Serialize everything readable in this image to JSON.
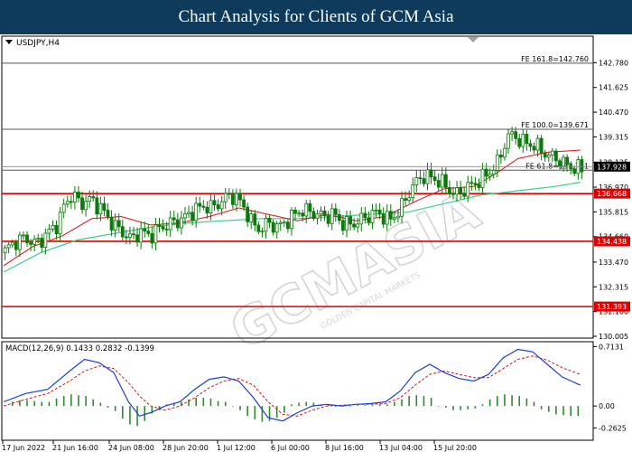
{
  "page": {
    "title": "Chart Analysis for Clients of GCM Asia"
  },
  "watermark": {
    "brand": "GCMASIA",
    "sub": "GOLDEN CAPITAL MARKETS"
  },
  "colors": {
    "candle": "#0a7a0a",
    "sma_fast": "#e01010",
    "sma_slow": "#38d08a",
    "sr_line": "#e00000",
    "fibo_line": "#555555",
    "price_badge": "#000000",
    "macd_line": "#1a3ee0",
    "signal_line": "#e01010",
    "hist": "#2e8b2e"
  },
  "chart_data": [
    {
      "type": "candlestick",
      "symbol_label": "USDJPY,H4",
      "ylim": [
        130.005,
        143.935
      ],
      "y_ticks": [
        "142.780",
        "141.625",
        "140.470",
        "139.315",
        "138.125",
        "136.970",
        "135.815",
        "134.660",
        "133.470",
        "132.315",
        "131.160",
        "130.005"
      ],
      "x_ticks": [
        "17 Jun 2022",
        "21 Jun 16:00",
        "24 Jun 08:00",
        "28 Jun 20:00",
        "1 Jul 12:00",
        "6 Jul 00:00",
        "8 Jul 16:00",
        "13 Jul 04:00",
        "15 Jul 20:00"
      ],
      "support_resistance": [
        {
          "label": "136.668",
          "value": 136.668
        },
        {
          "label": "134.438",
          "value": 134.438
        },
        {
          "label": "131.393",
          "value": 131.393
        }
      ],
      "fibonacci": [
        {
          "label": "FE 161.8=142.760",
          "value": 142.76
        },
        {
          "label": "FE 100.0=139.671",
          "value": 139.671
        },
        {
          "label": "FE 61.8=137.761",
          "value": 137.761
        }
      ],
      "current_price": {
        "label": "137.928",
        "value": 137.928
      },
      "price_path": [
        [
          0,
          133.9
        ],
        [
          3,
          134.4
        ],
        [
          6,
          134.6
        ],
        [
          9,
          134.3
        ],
        [
          12,
          134.8
        ],
        [
          15,
          135.3
        ],
        [
          17,
          136.3
        ],
        [
          19,
          136.6
        ],
        [
          21,
          136.2
        ],
        [
          24,
          136.4
        ],
        [
          27,
          135.9
        ],
        [
          30,
          135.2
        ],
        [
          33,
          134.8
        ],
        [
          35,
          134.5
        ],
        [
          37,
          134.9
        ],
        [
          40,
          134.7
        ],
        [
          43,
          135.1
        ],
        [
          46,
          135.3
        ],
        [
          49,
          135.5
        ],
        [
          52,
          135.9
        ],
        [
          55,
          136.1
        ],
        [
          57,
          136.0
        ],
        [
          60,
          136.4
        ],
        [
          62,
          136.6
        ],
        [
          64,
          136.4
        ],
        [
          66,
          135.9
        ],
        [
          68,
          135.2
        ],
        [
          70,
          135.0
        ],
        [
          72,
          135.3
        ],
        [
          75,
          135.1
        ],
        [
          78,
          135.5
        ],
        [
          81,
          135.9
        ],
        [
          84,
          135.8
        ],
        [
          87,
          135.6
        ],
        [
          90,
          135.7
        ],
        [
          93,
          135.2
        ],
        [
          96,
          135.3
        ],
        [
          99,
          135.6
        ],
        [
          102,
          135.8
        ],
        [
          105,
          135.4
        ],
        [
          108,
          135.9
        ],
        [
          111,
          136.9
        ],
        [
          114,
          137.5
        ],
        [
          117,
          137.4
        ],
        [
          120,
          137.1
        ],
        [
          123,
          136.6
        ],
        [
          126,
          136.9
        ],
        [
          129,
          137.2
        ],
        [
          132,
          137.6
        ],
        [
          135,
          138.2
        ],
        [
          137,
          139.3
        ],
        [
          139,
          139.4
        ],
        [
          141,
          139.1
        ],
        [
          143,
          139.0
        ],
        [
          145,
          138.9
        ],
        [
          147,
          138.6
        ],
        [
          149,
          138.4
        ],
        [
          151,
          138.3
        ],
        [
          153,
          138.0
        ],
        [
          155,
          137.9
        ],
        [
          157,
          137.8
        ]
      ],
      "sma_fast": [
        [
          0,
          133.3
        ],
        [
          8,
          134.2
        ],
        [
          16,
          134.7
        ],
        [
          24,
          135.5
        ],
        [
          32,
          135.6
        ],
        [
          40,
          135.2
        ],
        [
          48,
          135.3
        ],
        [
          56,
          135.6
        ],
        [
          64,
          136.0
        ],
        [
          72,
          135.7
        ],
        [
          80,
          135.4
        ],
        [
          88,
          135.7
        ],
        [
          96,
          135.4
        ],
        [
          104,
          135.6
        ],
        [
          112,
          136.3
        ],
        [
          120,
          136.9
        ],
        [
          128,
          137.0
        ],
        [
          134,
          137.6
        ],
        [
          140,
          138.3
        ],
        [
          148,
          138.6
        ],
        [
          157,
          138.7
        ]
      ],
      "sma_slow": [
        [
          0,
          133.0
        ],
        [
          10,
          133.9
        ],
        [
          20,
          134.5
        ],
        [
          30,
          134.8
        ],
        [
          40,
          135.1
        ],
        [
          50,
          135.3
        ],
        [
          60,
          135.4
        ],
        [
          70,
          135.5
        ],
        [
          80,
          135.5
        ],
        [
          90,
          135.6
        ],
        [
          100,
          135.7
        ],
        [
          110,
          135.8
        ],
        [
          120,
          136.2
        ],
        [
          130,
          136.6
        ],
        [
          140,
          136.8
        ],
        [
          150,
          137.0
        ],
        [
          157,
          137.2
        ]
      ]
    },
    {
      "type": "macd",
      "label": "MACD(12,26,9) 0.1433 0.2832 -0.1399",
      "ylim": [
        -0.4,
        0.75
      ],
      "y_ticks": [
        "0.7131",
        "0.00",
        "-0.2625"
      ],
      "macd": [
        [
          0,
          0.05
        ],
        [
          6,
          0.15
        ],
        [
          12,
          0.2
        ],
        [
          18,
          0.42
        ],
        [
          22,
          0.56
        ],
        [
          26,
          0.52
        ],
        [
          30,
          0.4
        ],
        [
          34,
          0.05
        ],
        [
          37,
          -0.12
        ],
        [
          40,
          -0.08
        ],
        [
          44,
          0.0
        ],
        [
          48,
          0.05
        ],
        [
          52,
          0.2
        ],
        [
          56,
          0.32
        ],
        [
          60,
          0.35
        ],
        [
          64,
          0.3
        ],
        [
          68,
          0.1
        ],
        [
          72,
          -0.14
        ],
        [
          76,
          -0.18
        ],
        [
          80,
          -0.08
        ],
        [
          84,
          0.0
        ],
        [
          88,
          0.02
        ],
        [
          92,
          0.0
        ],
        [
          96,
          0.02
        ],
        [
          100,
          0.03
        ],
        [
          104,
          0.05
        ],
        [
          108,
          0.18
        ],
        [
          112,
          0.4
        ],
        [
          116,
          0.5
        ],
        [
          120,
          0.4
        ],
        [
          124,
          0.33
        ],
        [
          128,
          0.3
        ],
        [
          132,
          0.38
        ],
        [
          136,
          0.58
        ],
        [
          140,
          0.68
        ],
        [
          144,
          0.65
        ],
        [
          148,
          0.5
        ],
        [
          152,
          0.35
        ],
        [
          157,
          0.25
        ]
      ],
      "signal": [
        [
          0,
          0.0
        ],
        [
          6,
          0.08
        ],
        [
          12,
          0.15
        ],
        [
          18,
          0.3
        ],
        [
          22,
          0.42
        ],
        [
          26,
          0.48
        ],
        [
          30,
          0.45
        ],
        [
          34,
          0.28
        ],
        [
          37,
          0.12
        ],
        [
          40,
          0.0
        ],
        [
          44,
          -0.05
        ],
        [
          48,
          0.0
        ],
        [
          52,
          0.1
        ],
        [
          56,
          0.22
        ],
        [
          60,
          0.3
        ],
        [
          64,
          0.33
        ],
        [
          68,
          0.25
        ],
        [
          72,
          0.05
        ],
        [
          76,
          -0.1
        ],
        [
          80,
          -0.12
        ],
        [
          84,
          -0.05
        ],
        [
          88,
          0.0
        ],
        [
          92,
          0.01
        ],
        [
          96,
          0.02
        ],
        [
          100,
          0.02
        ],
        [
          104,
          0.03
        ],
        [
          108,
          0.1
        ],
        [
          112,
          0.25
        ],
        [
          116,
          0.38
        ],
        [
          120,
          0.42
        ],
        [
          124,
          0.38
        ],
        [
          128,
          0.34
        ],
        [
          132,
          0.34
        ],
        [
          136,
          0.45
        ],
        [
          140,
          0.56
        ],
        [
          144,
          0.6
        ],
        [
          148,
          0.55
        ],
        [
          152,
          0.46
        ],
        [
          157,
          0.38
        ]
      ],
      "histogram": [
        [
          2,
          0.05
        ],
        [
          4,
          0.07
        ],
        [
          6,
          0.07
        ],
        [
          8,
          0.06
        ],
        [
          10,
          0.05
        ],
        [
          12,
          0.05
        ],
        [
          14,
          0.09
        ],
        [
          16,
          0.12
        ],
        [
          18,
          0.14
        ],
        [
          20,
          0.13
        ],
        [
          22,
          0.12
        ],
        [
          24,
          0.08
        ],
        [
          26,
          0.04
        ],
        [
          28,
          -0.02
        ],
        [
          30,
          -0.06
        ],
        [
          32,
          -0.15
        ],
        [
          34,
          -0.22
        ],
        [
          36,
          -0.24
        ],
        [
          38,
          -0.18
        ],
        [
          40,
          -0.09
        ],
        [
          42,
          -0.05
        ],
        [
          44,
          0.02
        ],
        [
          46,
          0.04
        ],
        [
          48,
          0.05
        ],
        [
          50,
          0.08
        ],
        [
          52,
          0.1
        ],
        [
          54,
          0.1
        ],
        [
          56,
          0.09
        ],
        [
          58,
          0.06
        ],
        [
          60,
          0.05
        ],
        [
          62,
          0.0
        ],
        [
          64,
          -0.05
        ],
        [
          66,
          -0.12
        ],
        [
          68,
          -0.16
        ],
        [
          70,
          -0.19
        ],
        [
          72,
          -0.18
        ],
        [
          74,
          -0.14
        ],
        [
          76,
          -0.08
        ],
        [
          78,
          0.02
        ],
        [
          80,
          0.04
        ],
        [
          82,
          0.05
        ],
        [
          84,
          0.04
        ],
        [
          86,
          0.02
        ],
        [
          88,
          0.02
        ],
        [
          90,
          -0.01
        ],
        [
          92,
          -0.01
        ],
        [
          94,
          0.0
        ],
        [
          96,
          0.01
        ],
        [
          98,
          0.01
        ],
        [
          100,
          0.01
        ],
        [
          102,
          0.02
        ],
        [
          104,
          0.02
        ],
        [
          106,
          0.05
        ],
        [
          108,
          0.08
        ],
        [
          110,
          0.12
        ],
        [
          112,
          0.13
        ],
        [
          114,
          0.12
        ],
        [
          116,
          0.1
        ],
        [
          118,
          0.0
        ],
        [
          120,
          -0.02
        ],
        [
          122,
          -0.05
        ],
        [
          124,
          -0.05
        ],
        [
          126,
          -0.04
        ],
        [
          128,
          -0.03
        ],
        [
          130,
          0.02
        ],
        [
          132,
          0.08
        ],
        [
          134,
          0.12
        ],
        [
          136,
          0.14
        ],
        [
          138,
          0.13
        ],
        [
          140,
          0.12
        ],
        [
          142,
          0.09
        ],
        [
          144,
          0.05
        ],
        [
          146,
          -0.04
        ],
        [
          148,
          -0.07
        ],
        [
          150,
          -0.1
        ],
        [
          152,
          -0.11
        ],
        [
          154,
          -0.12
        ],
        [
          156,
          -0.12
        ]
      ]
    }
  ]
}
